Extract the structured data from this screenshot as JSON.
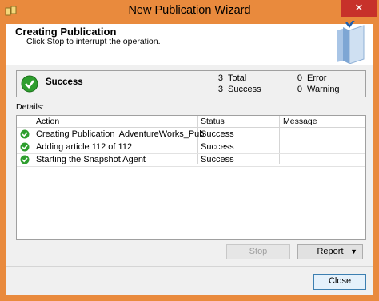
{
  "window": {
    "title": "New Publication Wizard",
    "close_glyph": "✕"
  },
  "header": {
    "title": "Creating Publication",
    "subtitle": "Click Stop to interrupt the operation."
  },
  "summary": {
    "status": "Success",
    "total_count": "3",
    "total_label": "Total",
    "success_count": "3",
    "success_label": "Success",
    "error_count": "0",
    "error_label": "Error",
    "warning_count": "0",
    "warning_label": "Warning"
  },
  "details": {
    "label": "Details:",
    "columns": [
      "Action",
      "Status",
      "Message"
    ],
    "rows": [
      {
        "action": "Creating Publication 'AdventureWorks_Pub'",
        "status": "Success",
        "message": ""
      },
      {
        "action": "Adding article 112 of 112",
        "status": "Success",
        "message": ""
      },
      {
        "action": "Starting the Snapshot Agent",
        "status": "Success",
        "message": ""
      }
    ]
  },
  "buttons": {
    "stop": "Stop",
    "report": "Report",
    "report_arrow": "▼",
    "close": "Close"
  },
  "colors": {
    "success_green": "#2e9e2e",
    "title_bar": "#e98a3d",
    "close_red": "#c7312a"
  }
}
